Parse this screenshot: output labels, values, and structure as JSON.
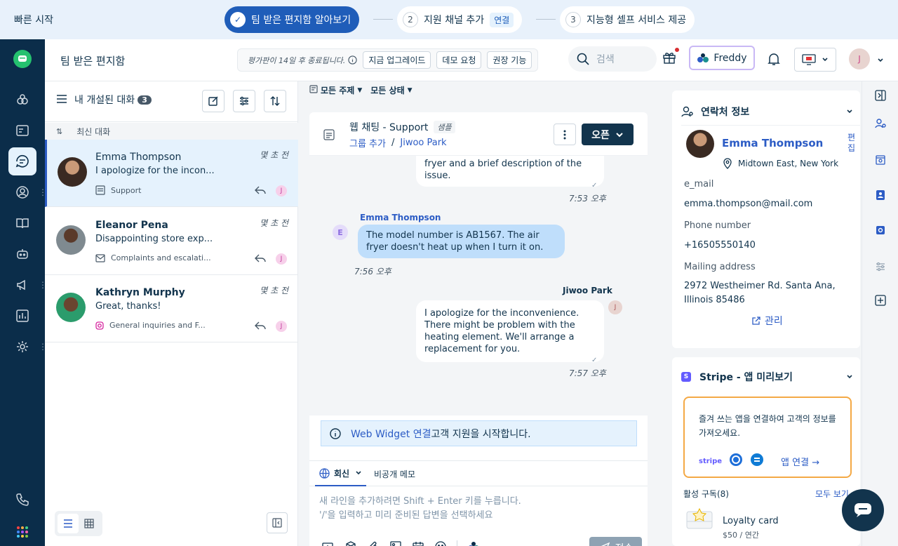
{
  "quickstart": {
    "title": "빠른 시작",
    "steps": [
      {
        "num": "✓",
        "label": "팀 받은 편지함 알아보기"
      },
      {
        "num": "2",
        "label": "지원 채널 추가",
        "chip": "연결"
      },
      {
        "num": "3",
        "label": "지능형 셀프 서비스 제공"
      }
    ]
  },
  "header": {
    "title": "팀 받은 편지함",
    "trial_text": "평가판이 14일 후 종료됩니다.",
    "upgrade": "지금 업그레이드",
    "demo": "데모 요청",
    "recommended": "권장 기능",
    "search_placeholder": "검색",
    "freddy": "Freddy",
    "avatar_initial": "J"
  },
  "list": {
    "title": "내 개설된 대화",
    "count": "3",
    "sort_label": "최신 대화",
    "conversations": [
      {
        "name": "Emma Thompson",
        "snippet": "I apologize for the incon...",
        "group": "Support",
        "time": "몇 초 전",
        "assignee": "J"
      },
      {
        "name": "Eleanor Pena",
        "snippet": "Disappointing store exp...",
        "group": "Complaints and escalati...",
        "time": "몇 초 전",
        "assignee": "J"
      },
      {
        "name": "Kathryn Murphy",
        "snippet": "Great, thanks!",
        "group": "General inquiries and F...",
        "time": "몇 초 전",
        "assignee": "J"
      }
    ]
  },
  "chat": {
    "filter_topic": "모든 주제",
    "filter_status": "모든 상태",
    "title": "웹 채팅 - Support",
    "sample_tag": "샘플",
    "breadcrumb_group": "그룹 추가",
    "breadcrumb_agent": "Jiwoo Park",
    "open_btn": "오픈",
    "messages": [
      {
        "text": "fryer and a brief description of the issue.",
        "time": "7:53 오후"
      },
      {
        "sender": "Emma Thompson",
        "initial": "E",
        "text": "The model number is AB1567. The air fryer doesn't heat up when I turn it on.",
        "time": "7:56 오후"
      },
      {
        "sender": "Jiwoo Park",
        "initial": "J",
        "text": "I apologize for the inconvenience. There might be problem with the heating element. We'll arrange a replacement for you.",
        "time": "7:57 오후"
      }
    ],
    "banner_link": "Web Widget 연결",
    "banner_text": " 고객 지원을 시작합니다.",
    "tab_reply": "회신",
    "tab_note": "비공개 메모",
    "placeholder_1": "새 라인을 추가하려면 Shift + Enter 키를 누릅니다.",
    "placeholder_2": "'/'을 입력하고 미리 준비된 답변을 선택하세요",
    "send": "전송"
  },
  "contact": {
    "section_title": "연락처 정보",
    "name": "Emma Thompson",
    "edit": "편집",
    "location": "Midtown East, New York",
    "email_label": "e_mail",
    "email": "emma.thompson@mail.com",
    "phone_label": "Phone number",
    "phone": "+16505550140",
    "address_label": "Mailing address",
    "address": "2972 Westheimer Rd. Santa Ana, Illinois 85486",
    "manage": "관리"
  },
  "stripe": {
    "title": "Stripe - 앱 미리보기",
    "promo": "즐겨 쓰는 앱을 연결하여 고객의 정보를 가져오세요.",
    "stripe_logo": "stripe",
    "connect": "앱 연결 →",
    "subs_label": "활성 구독(8)",
    "view_all": "모두 보기",
    "card_name": "Loyalty card",
    "card_price": "$50 / 연간"
  },
  "colors": {
    "accent": "#1f5db9",
    "nav": "#0b2d4a",
    "dark_button": "#12344d",
    "promo_border": "#f4a945"
  }
}
